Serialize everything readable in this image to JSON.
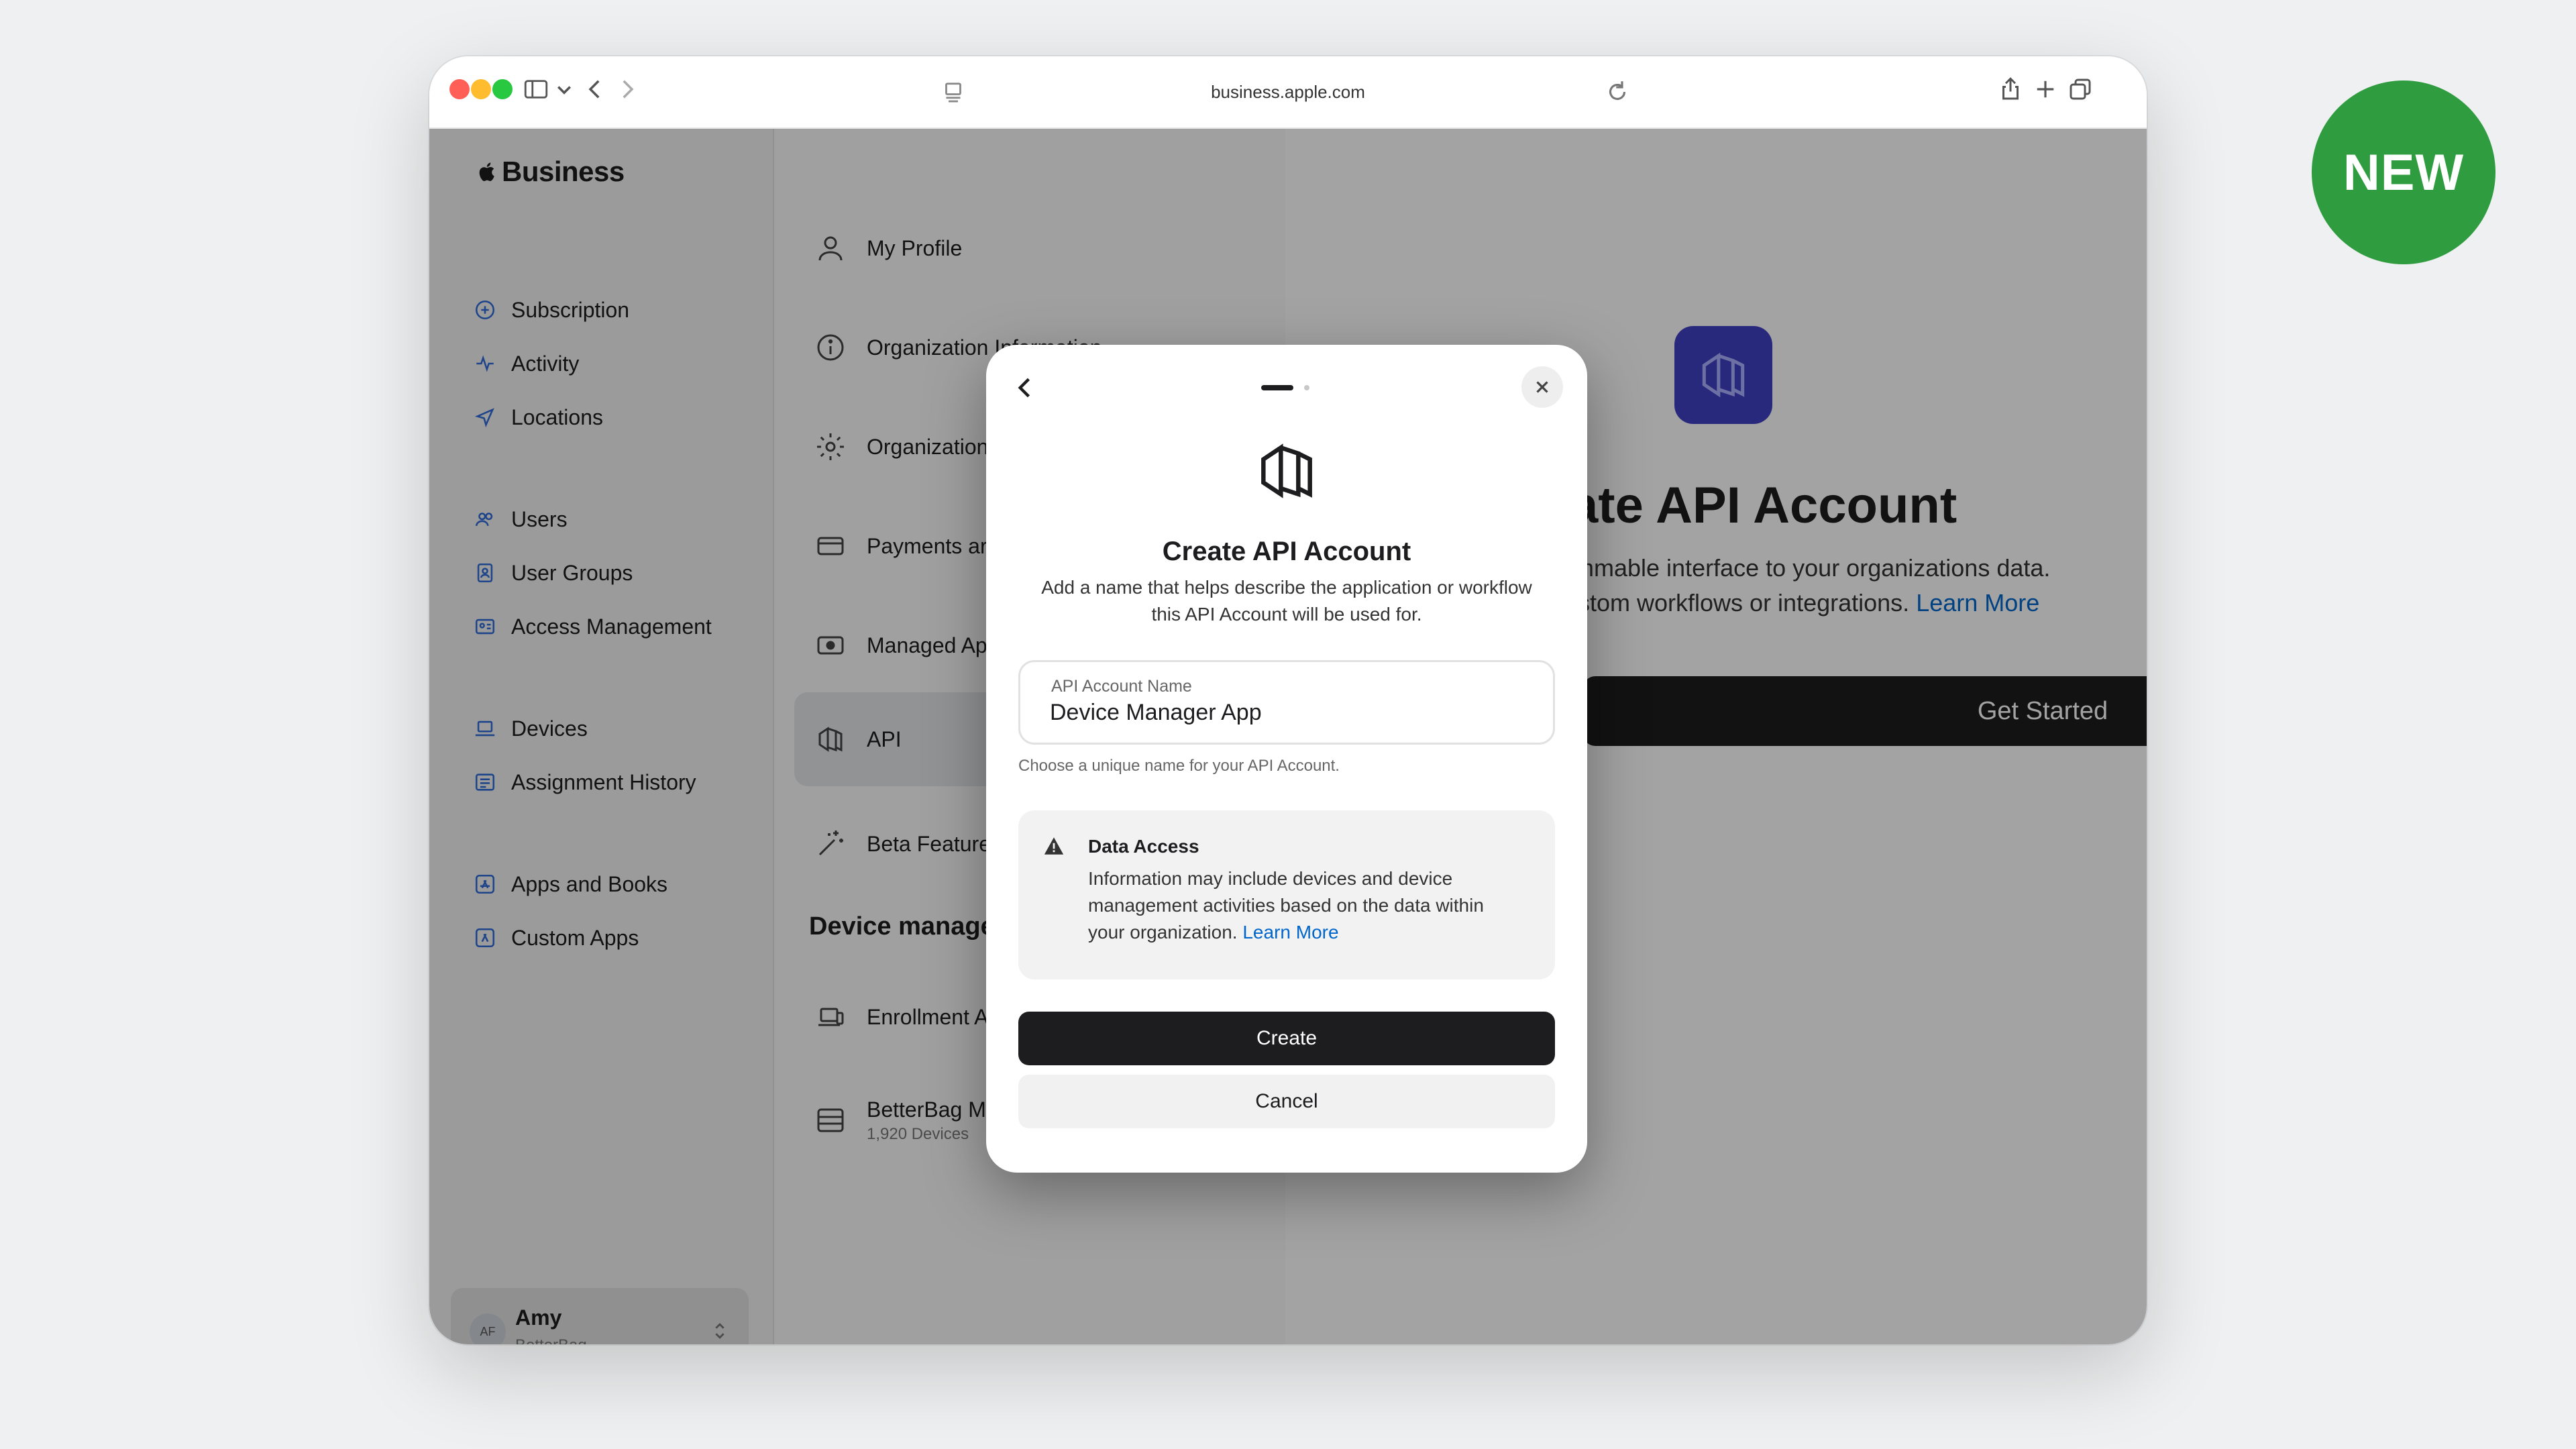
{
  "browser": {
    "url": "business.apple.com",
    "traffic_lights": {
      "close": "#ff5f57",
      "minimize": "#febc2e",
      "zoom": "#28c840"
    }
  },
  "sidebar": {
    "brand": "Business",
    "groups": [
      [
        {
          "label": "Subscription",
          "icon": "plus-circle-icon"
        },
        {
          "label": "Activity",
          "icon": "activity-icon"
        },
        {
          "label": "Locations",
          "icon": "location-arrow-icon"
        }
      ],
      [
        {
          "label": "Users",
          "icon": "users-icon"
        },
        {
          "label": "User Groups",
          "icon": "user-group-icon"
        },
        {
          "label": "Access Management",
          "icon": "id-card-icon"
        }
      ],
      [
        {
          "label": "Devices",
          "icon": "laptop-icon"
        },
        {
          "label": "Assignment History",
          "icon": "list-icon"
        }
      ],
      [
        {
          "label": "Apps and Books",
          "icon": "app-store-icon"
        },
        {
          "label": "Custom Apps",
          "icon": "custom-app-icon"
        }
      ]
    ],
    "user": {
      "initials": "AF",
      "name": "Amy",
      "org": "BetterBag"
    }
  },
  "settings_menu": {
    "items": [
      {
        "label": "My Profile",
        "icon": "person-icon"
      },
      {
        "label": "Organization Information",
        "icon": "info-icon"
      },
      {
        "label": "Organization",
        "icon": "gear-icon"
      },
      {
        "label": "Payments ar",
        "icon": "card-icon"
      },
      {
        "label": "Managed Ap",
        "icon": "apple-pay-icon"
      },
      {
        "label": "API",
        "icon": "api-icon",
        "selected": true
      },
      {
        "label": "Beta Feature",
        "icon": "sparkle-icon"
      }
    ],
    "section_title": "Device manage",
    "section_items": [
      {
        "label": "Enrollment A",
        "icon": "enrollment-icon"
      },
      {
        "label": "BetterBag M",
        "sublabel": "1,920 Devices",
        "icon": "server-icon"
      }
    ]
  },
  "right_pane": {
    "title": "ate API Account",
    "desc_line1": "mmable interface to your organizations data.",
    "desc_line2": "stom workflows or integrations.",
    "learn_more": "Learn More",
    "get_started": "Get Started",
    "tile_color": "#3f40c4"
  },
  "modal": {
    "title": "Create API Account",
    "subtitle_line1": "Add a name that helps describe the application or workflow",
    "subtitle_line2": "this API Account will be used for.",
    "field_label": "API Account Name",
    "field_value": "Device Manager App",
    "field_hint": "Choose a unique name for your API Account.",
    "notice_title": "Data Access",
    "notice_line1": "Information may include devices and device",
    "notice_line2": "management activities based on the data within",
    "notice_line3": "your organization.",
    "notice_link": "Learn More",
    "create_label": "Create",
    "cancel_label": "Cancel",
    "link_color": "#0066cc"
  },
  "badge": {
    "label": "NEW",
    "color": "#2f9c3f"
  }
}
